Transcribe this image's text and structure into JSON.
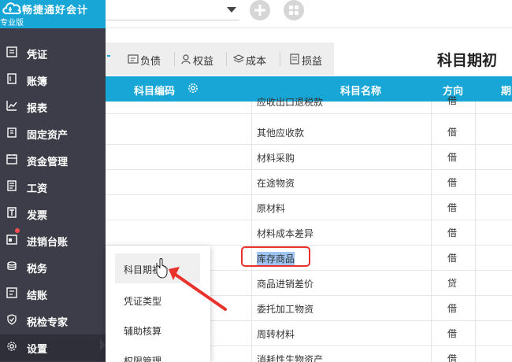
{
  "app": {
    "title": "畅捷通好会计",
    "edition": "专业版",
    "brand_color": "#17a6d6"
  },
  "toolbar": {
    "add_icon": "plus-circle-icon",
    "apps_icon": "grid-icon"
  },
  "sidebar": {
    "items": [
      {
        "label": "凭证",
        "icon": "voucher-icon"
      },
      {
        "label": "账簿",
        "icon": "ledger-icon"
      },
      {
        "label": "报表",
        "icon": "chart-icon"
      },
      {
        "label": "固定资产",
        "icon": "building-icon"
      },
      {
        "label": "资金管理",
        "icon": "calendar-icon"
      },
      {
        "label": "工资",
        "icon": "salary-icon"
      },
      {
        "label": "发票",
        "icon": "invoice-icon"
      },
      {
        "label": "进销台账",
        "icon": "inventory-icon"
      },
      {
        "label": "税务",
        "icon": "coins-icon"
      },
      {
        "label": "结账",
        "icon": "checkout-icon"
      },
      {
        "label": "税检专家",
        "icon": "shield-icon"
      },
      {
        "label": "设置",
        "icon": "gear-icon"
      }
    ]
  },
  "tabs": [
    {
      "label": "负债",
      "icon": "liability-icon"
    },
    {
      "label": "权益",
      "icon": "equity-icon"
    },
    {
      "label": "成本",
      "icon": "layers-icon"
    },
    {
      "label": "损益",
      "icon": "profit-icon"
    }
  ],
  "page_title": "科目期初",
  "table": {
    "headers": {
      "code": "科目编码",
      "name": "科目名称",
      "direction": "方向",
      "period": "期"
    },
    "rows": [
      {
        "name": "应收出口退税款",
        "direction": "借"
      },
      {
        "name": "其他应收款",
        "direction": "借"
      },
      {
        "name": "材料采购",
        "direction": "借"
      },
      {
        "name": "在途物资",
        "direction": "借"
      },
      {
        "name": "原材料",
        "direction": "借"
      },
      {
        "name": "材料成本差异",
        "direction": "借"
      },
      {
        "name": "库存商品",
        "direction": "借"
      },
      {
        "name": "商品进销差价",
        "direction": "贷"
      },
      {
        "name": "委托加工物资",
        "direction": "借"
      },
      {
        "name": "周转材料",
        "direction": "借"
      },
      {
        "name": "消耗性生物资产",
        "direction": "借"
      }
    ]
  },
  "popup_menu": {
    "items": [
      {
        "label": "科目期初"
      },
      {
        "label": "凭证类型"
      },
      {
        "label": "辅助核算"
      },
      {
        "label": "权限管理"
      }
    ]
  },
  "annotation_color": "#e8322b"
}
